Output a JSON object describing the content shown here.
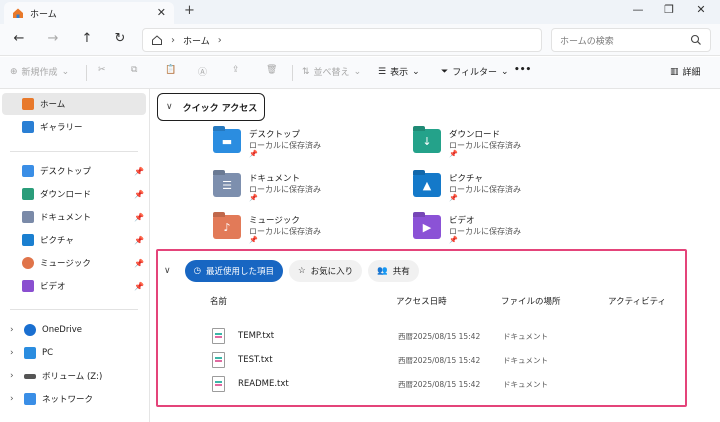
{
  "window": {
    "tab_title": "ホーム",
    "tab_close": "✕",
    "tab_add": "+",
    "minimize": "—",
    "maximize": "❐",
    "close": "✕"
  },
  "nav": {
    "back": "←",
    "forward": "→",
    "up": "↑",
    "refresh": "↻",
    "breadcrumb_home": "ホーム",
    "search_placeholder": "ホームの検索"
  },
  "toolbar": {
    "new_label": "新規作成",
    "sort_label": "並べ替え",
    "view_label": "表示",
    "filter_label": "フィルター",
    "more_label": "•••",
    "details_label": "詳細"
  },
  "sidebar": {
    "home": "ホーム",
    "gallery": "ギャラリー",
    "pinned": [
      {
        "label": "デスクトップ"
      },
      {
        "label": "ダウンロード"
      },
      {
        "label": "ドキュメント"
      },
      {
        "label": "ピクチャ"
      },
      {
        "label": "ミュージック"
      },
      {
        "label": "ビデオ"
      }
    ],
    "tree": [
      {
        "label": "OneDrive"
      },
      {
        "label": "PC"
      },
      {
        "label": "ボリューム (Z:)"
      },
      {
        "label": "ネットワーク"
      }
    ]
  },
  "quick_access": {
    "title": "クイック アクセス",
    "folders": [
      {
        "name": "デスクトップ",
        "sub": "ローカルに保存済み"
      },
      {
        "name": "ダウンロード",
        "sub": "ローカルに保存済み"
      },
      {
        "name": "ドキュメント",
        "sub": "ローカルに保存済み"
      },
      {
        "name": "ピクチャ",
        "sub": "ローカルに保存済み"
      },
      {
        "name": "ミュージック",
        "sub": "ローカルに保存済み"
      },
      {
        "name": "ビデオ",
        "sub": "ローカルに保存済み"
      }
    ]
  },
  "recent": {
    "tabs": {
      "recent": "最近使用した項目",
      "favorites": "お気に入り",
      "shared": "共有"
    },
    "columns": {
      "name": "名前",
      "accessed": "アクセス日時",
      "location": "ファイルの場所",
      "activity": "アクティビティ"
    },
    "files": [
      {
        "name": "TEMP.txt",
        "date": "西暦2025/08/15 15:42",
        "location": "ドキュメント"
      },
      {
        "name": "TEST.txt",
        "date": "西暦2025/08/15 15:42",
        "location": "ドキュメント"
      },
      {
        "name": "README.txt",
        "date": "西暦2025/08/15 15:42",
        "location": "ドキュメント"
      }
    ]
  },
  "colors": {
    "accent": "#1866c2",
    "highlight_border": "#e4447a"
  }
}
